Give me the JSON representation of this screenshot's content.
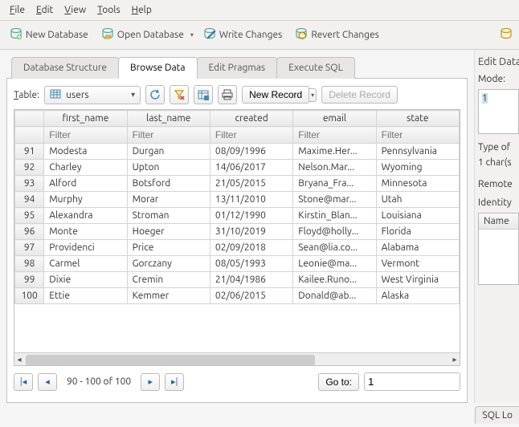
{
  "menu": {
    "file": "File",
    "edit": "Edit",
    "view": "View",
    "tools": "Tools",
    "help": "Help"
  },
  "toolbar": {
    "new_db": "New Database",
    "open_db": "Open Database",
    "write_changes": "Write Changes",
    "revert_changes": "Revert Changes"
  },
  "tabs": {
    "structure": "Database Structure",
    "browse": "Browse Data",
    "pragmas": "Edit Pragmas",
    "sql": "Execute SQL"
  },
  "table_bar": {
    "label": "Table:",
    "selected": "users",
    "new_record": "New Record",
    "delete_record": "Delete Record"
  },
  "columns": [
    "first_name",
    "last_name",
    "created",
    "email",
    "state"
  ],
  "filter_placeholder": "Filter",
  "rows": [
    {
      "n": 91,
      "first_name": "Modesta",
      "last_name": "Durgan",
      "created": "08/09/1996",
      "email": "Maxime.Her...",
      "state": "Pennsylvania"
    },
    {
      "n": 92,
      "first_name": "Charley",
      "last_name": "Upton",
      "created": "14/06/2017",
      "email": "Nelson.Mar...",
      "state": "Wyoming"
    },
    {
      "n": 93,
      "first_name": "Alford",
      "last_name": "Botsford",
      "created": "21/05/2015",
      "email": "Bryana_Fra...",
      "state": "Minnesota"
    },
    {
      "n": 94,
      "first_name": "Murphy",
      "last_name": "Morar",
      "created": "13/11/2010",
      "email": "Stone@mar...",
      "state": "Utah"
    },
    {
      "n": 95,
      "first_name": "Alexandra",
      "last_name": "Stroman",
      "created": "01/12/1990",
      "email": "Kirstin_Blan...",
      "state": "Louisiana"
    },
    {
      "n": 96,
      "first_name": "Monte",
      "last_name": "Hoeger",
      "created": "31/10/2019",
      "email": "Floyd@holly...",
      "state": "Florida"
    },
    {
      "n": 97,
      "first_name": "Providenci",
      "last_name": "Price",
      "created": "02/09/2018",
      "email": "Sean@lia.co...",
      "state": "Alabama"
    },
    {
      "n": 98,
      "first_name": "Carmel",
      "last_name": "Gorczany",
      "created": "08/05/1993",
      "email": "Leonie@ma...",
      "state": "Vermont"
    },
    {
      "n": 99,
      "first_name": "Dixie",
      "last_name": "Cremin",
      "created": "21/04/1986",
      "email": "Kailee.Runo...",
      "state": "West Virginia"
    },
    {
      "n": 100,
      "first_name": "Ettie",
      "last_name": "Kemmer",
      "created": "02/06/2015",
      "email": "Donald@ab...",
      "state": "Alaska"
    }
  ],
  "pager": {
    "position": "90 - 100 of 100",
    "goto_label": "Go to:",
    "goto_value": "1"
  },
  "right": {
    "title": "Edit Data",
    "mode_label": "Mode:",
    "edit_value": "1",
    "type_line": "Type of",
    "chars_line": "1 char(s",
    "remote_label": "Remote",
    "identity_label": "Identity",
    "name_header": "Name",
    "sql_log": "SQL Lo"
  }
}
